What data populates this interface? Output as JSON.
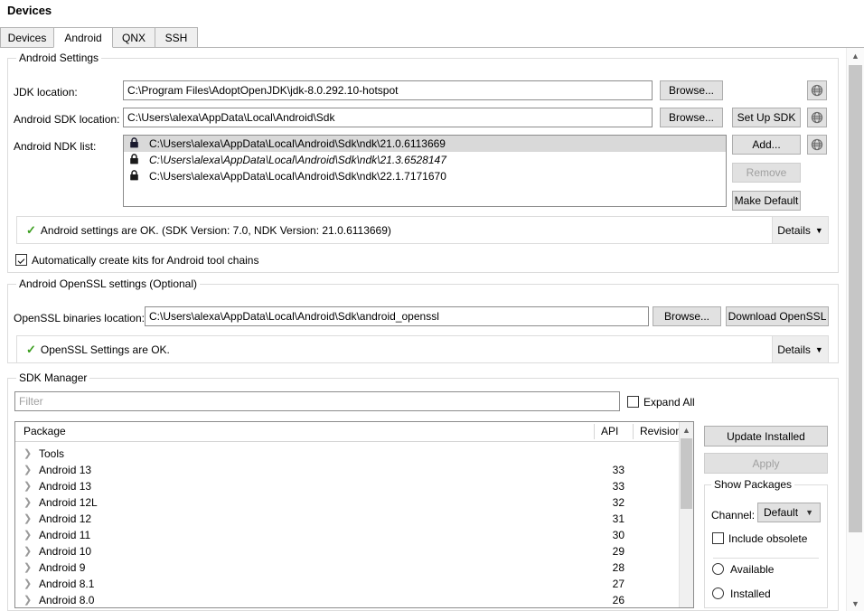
{
  "window": {
    "title": "Devices"
  },
  "tabs": [
    {
      "label": "Devices",
      "active": false
    },
    {
      "label": "Android",
      "active": true
    },
    {
      "label": "QNX",
      "active": false
    },
    {
      "label": "SSH",
      "active": false
    }
  ],
  "android_settings": {
    "legend": "Android Settings",
    "jdk": {
      "label": "JDK location:",
      "value": "C:\\Program Files\\AdoptOpenJDK\\jdk-8.0.292.10-hotspot",
      "browse_label": "Browse...",
      "globe_icon": "globe-icon"
    },
    "sdk": {
      "label": "Android SDK location:",
      "value": "C:\\Users\\alexa\\AppData\\Local\\Android\\Sdk",
      "browse_label": "Browse...",
      "setup_label": "Set Up SDK",
      "globe_icon": "globe-icon"
    },
    "ndk": {
      "label": "Android NDK list:",
      "items": [
        {
          "path": "C:\\Users\\alexa\\AppData\\Local\\Android\\Sdk\\ndk\\21.0.6113669",
          "selected": true,
          "italic": false,
          "icon": "lock-icon"
        },
        {
          "path": "C:\\Users\\alexa\\AppData\\Local\\Android\\Sdk\\ndk\\21.3.6528147",
          "selected": false,
          "italic": true,
          "icon": "lock-icon"
        },
        {
          "path": "C:\\Users\\alexa\\AppData\\Local\\Android\\Sdk\\ndk\\22.1.7171670",
          "selected": false,
          "italic": false,
          "icon": "lock-icon"
        }
      ],
      "add_label": "Add...",
      "remove_label": "Remove",
      "make_default_label": "Make Default",
      "globe_icon": "globe-icon"
    },
    "status": {
      "message": "Android settings are OK. (SDK Version: 7.0, NDK Version: 21.0.6113669)",
      "check_icon": "checkmark-icon",
      "details_label": "Details",
      "details_arrow": "▼"
    },
    "auto_kits": {
      "label": "Automatically create kits for Android tool chains",
      "checked": true
    }
  },
  "openssl": {
    "legend": "Android OpenSSL settings (Optional)",
    "binaries": {
      "label": "OpenSSL binaries location:",
      "value": "C:\\Users\\alexa\\AppData\\Local\\Android\\Sdk\\android_openssl",
      "browse_label": "Browse...",
      "download_label": "Download OpenSSL"
    },
    "status": {
      "message": "OpenSSL Settings are OK.",
      "check_icon": "checkmark-icon",
      "details_label": "Details",
      "details_arrow": "▼"
    }
  },
  "sdk_manager": {
    "legend": "SDK Manager",
    "filter": {
      "placeholder": "Filter",
      "value": ""
    },
    "expand_all": {
      "label": "Expand All",
      "checked": false
    },
    "table": {
      "columns": [
        "Package",
        "API",
        "Revision"
      ],
      "rows": [
        {
          "package": "Tools",
          "api": "",
          "revision": ""
        },
        {
          "package": "Android 13",
          "api": "33",
          "revision": ""
        },
        {
          "package": "Android 13",
          "api": "33",
          "revision": ""
        },
        {
          "package": "Android 12L",
          "api": "32",
          "revision": ""
        },
        {
          "package": "Android 12",
          "api": "31",
          "revision": ""
        },
        {
          "package": "Android 11",
          "api": "30",
          "revision": ""
        },
        {
          "package": "Android 10",
          "api": "29",
          "revision": ""
        },
        {
          "package": "Android 9",
          "api": "28",
          "revision": ""
        },
        {
          "package": "Android 8.1",
          "api": "27",
          "revision": ""
        },
        {
          "package": "Android 8.0",
          "api": "26",
          "revision": ""
        }
      ]
    },
    "update_installed_label": "Update Installed",
    "apply_label": "Apply",
    "show_packages": {
      "legend": "Show Packages",
      "channel_label": "Channel:",
      "channel_value": "Default",
      "include_obsolete": {
        "label": "Include obsolete",
        "checked": false
      },
      "available": {
        "label": "Available",
        "checked": false
      },
      "installed": {
        "label": "Installed",
        "checked": false
      }
    }
  },
  "colors": {
    "accent_ok": "#3a9e1e",
    "button_face": "#e1e1e1",
    "selection": "#d9d9d9",
    "scrollbar_thumb": "#c6c6c6"
  }
}
